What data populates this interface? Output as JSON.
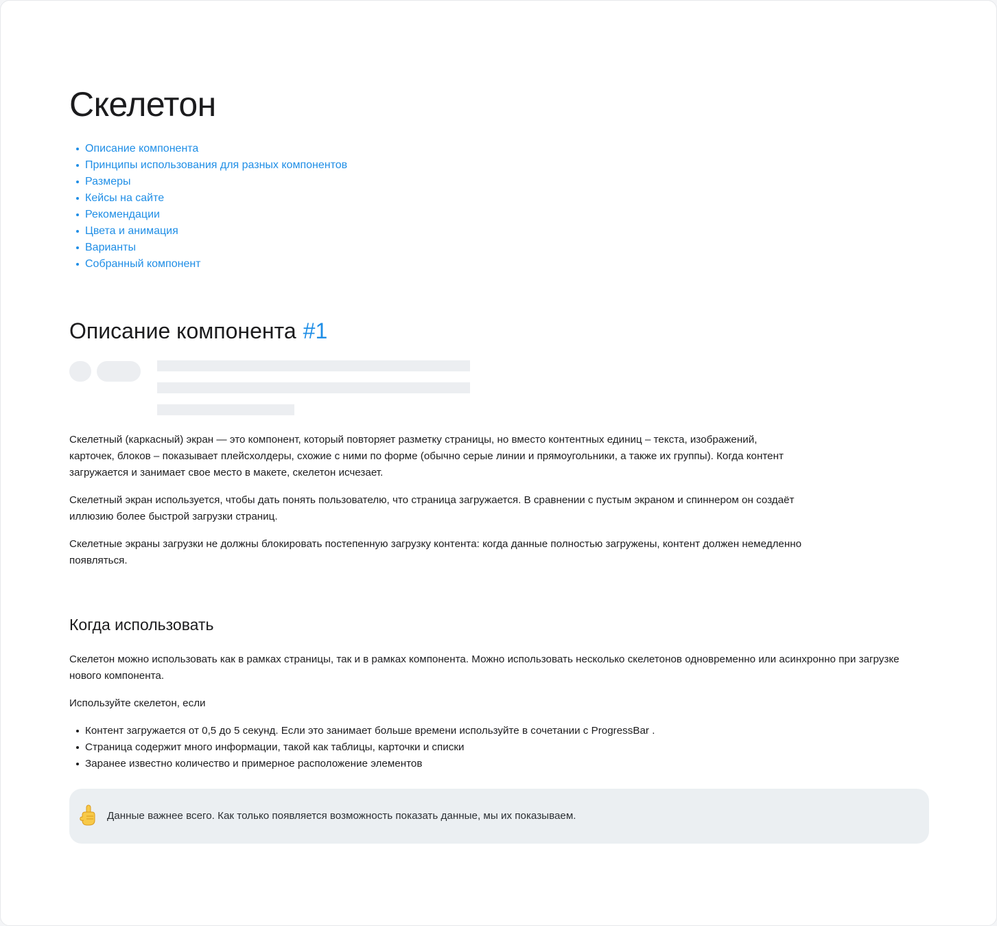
{
  "page": {
    "title": "Скелетон"
  },
  "toc": [
    "Описание компонента",
    "Принципы использования для разных компонентов",
    "Размеры",
    "Кейсы на сайте",
    "Рекомендации",
    "Цвета и анимация",
    "Варианты",
    "Собранный компонент"
  ],
  "description": {
    "title": "Описание компонента",
    "anchor": "#1",
    "paragraphs": [
      "Скелетный (каркасный) экран  — это компонент, который  повторяет  разметку страницы, но вместо контентных единиц – текста, изображений, карточек, блоков – показывает плейсхолдеры, схожие с ними по форме (обычно серые линии и прямоугольники, а также их группы). Когда контент загружается и занимает свое место в макете, скелетон исчезает.",
      "Скелетный экран используется, чтобы дать понять пользователю, что страница загружается. В сравнении с пустым экраном и спиннером он создаёт иллюзию более быстрой загрузки страниц.",
      "Скелетные экраны загрузки не должны блокировать постепенную загрузку контента: когда данные полностью загружены, контент должен немедленно появляться."
    ]
  },
  "when_to_use": {
    "title": "Когда использовать",
    "intro": "Скелетон можно использовать как в рамках страницы, так и в рамках компонента.  Можно использовать несколько скелетонов одновременно или асинхронно при загрузке нового компонента.",
    "lead": "Используйте скелетон, если",
    "bullets": [
      "Контент загружается от 0,5  до 5 секунд.  Если это занимает больше времени используйте  в сочетании с ProgressBar .",
      "Страница содержит много информации, такой как таблицы, карточки и списки",
      "Заранее известно количество и примерное расположение элементов"
    ]
  },
  "callout": {
    "icon": "pointing-finger-icon",
    "text": "Данные важнее всего. Как только появляется возможность показать данные, мы их показываем."
  },
  "colors": {
    "link": "#1f8ee6",
    "skeleton": "#eceef1",
    "callout_bg": "#ebeff2"
  }
}
